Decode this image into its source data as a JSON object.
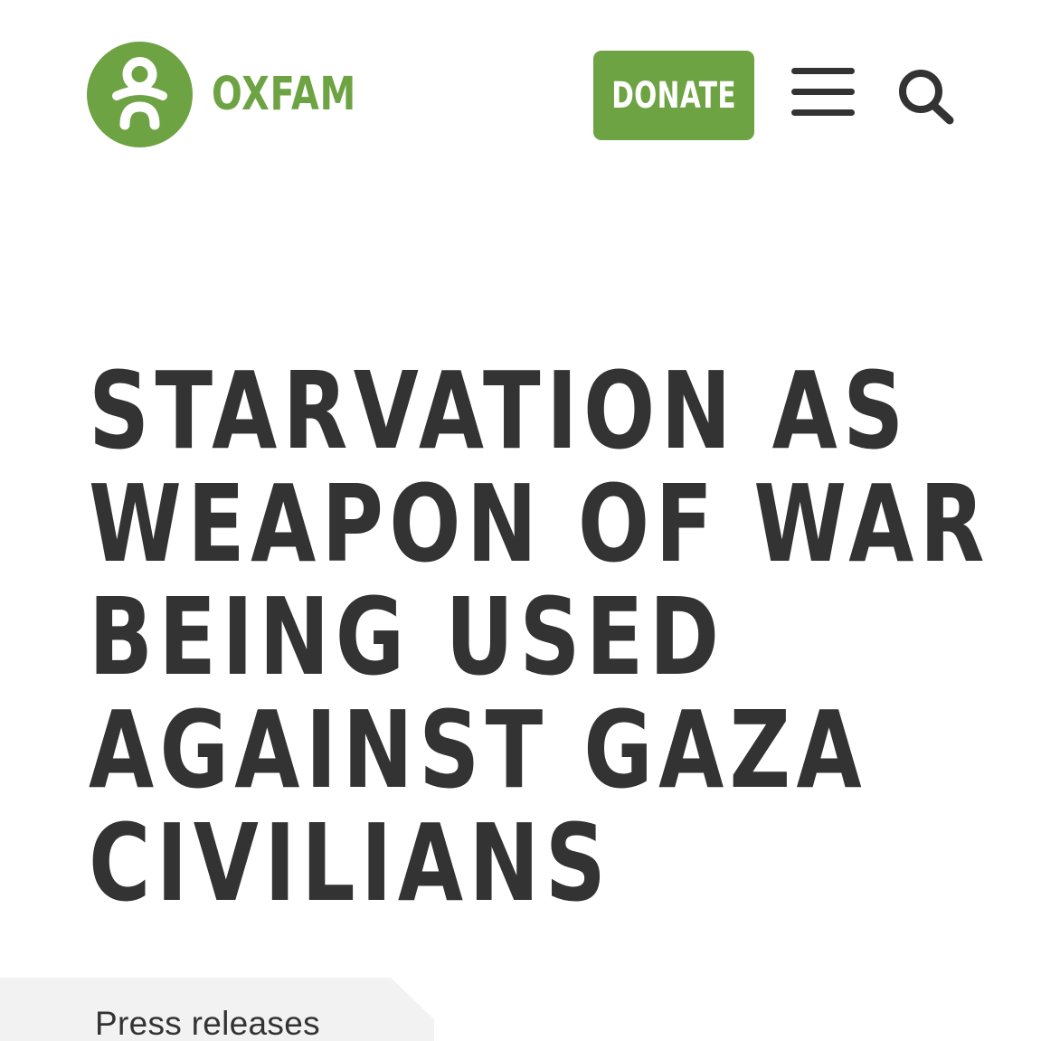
{
  "brand": {
    "name": "OXFAM",
    "logo_icon": "oxfam-person-icon",
    "color_green": "#6ea344",
    "color_text": "#333333"
  },
  "header": {
    "donate_label": "DONATE",
    "menu_icon": "hamburger-menu-icon",
    "search_icon": "search-icon"
  },
  "article": {
    "title_lines": [
      "STARVATION AS",
      "WEAPON OF WAR",
      "BEING USED",
      "AGAINST GAZA",
      "CIVILIANS"
    ]
  },
  "category": {
    "label": "Press releases",
    "background": "#f2f2f2"
  }
}
